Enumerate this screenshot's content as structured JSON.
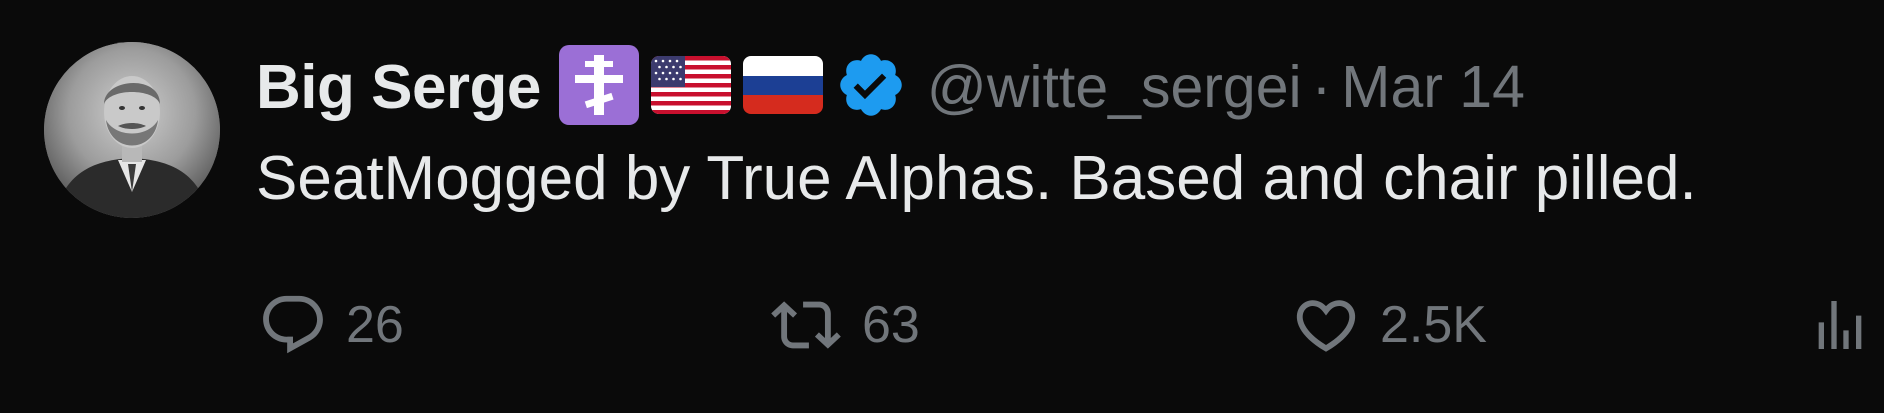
{
  "tweet": {
    "author": {
      "display_name": "Big Serge",
      "handle": "@witte_sergei",
      "verified": true,
      "avatar_alt": "vintage portrait"
    },
    "timestamp": "Mar 14",
    "separator": "·",
    "text": "SeatMogged by True Alphas. Based and chair pilled.",
    "name_emojis": [
      "orthodox-cross",
      "us-flag",
      "russia-flag"
    ],
    "actions": {
      "reply": {
        "icon": "reply-icon",
        "count": "26"
      },
      "retweet": {
        "icon": "retweet-icon",
        "count": "63"
      },
      "like": {
        "icon": "heart-icon",
        "count": "2.5K"
      },
      "views": {
        "icon": "views-icon",
        "count": ""
      }
    }
  },
  "colors": {
    "background": "#0a0a0a",
    "primary_text": "#e7e9ea",
    "secondary_text": "#71767b",
    "verified_blue": "#1d9bf0",
    "orthodox_purple": "#9b6fd6"
  }
}
